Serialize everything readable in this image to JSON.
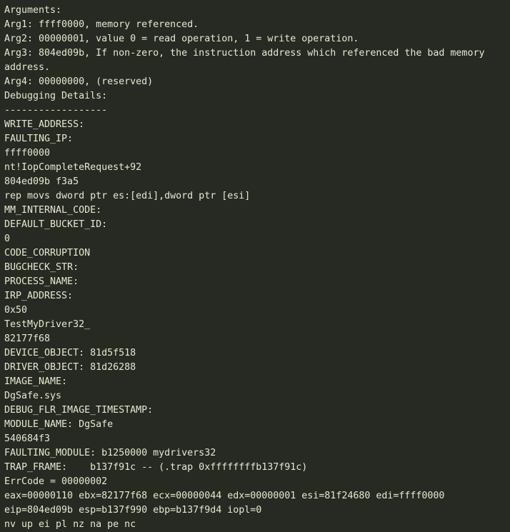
{
  "terminal": {
    "app": "windbg-bugcheck-analysis",
    "colors": {
      "background": "#262a22",
      "foreground": "#e8e8d0"
    },
    "lines": [
      "Arguments:",
      "Arg1: ffff0000, memory referenced.",
      "Arg2: 00000001, value 0 = read operation, 1 = write operation.",
      "Arg3: 804ed09b, If non-zero, the instruction address which referenced the bad memory",
      "address.",
      "Arg4: 00000000, (reserved)",
      "Debugging Details:",
      "------------------",
      "WRITE_ADDRESS:",
      "FAULTING_IP:",
      "ffff0000",
      "nt!IopCompleteRequest+92",
      "804ed09b f3a5",
      "rep movs dword ptr es:[edi],dword ptr [esi]",
      "MM_INTERNAL_CODE:",
      "DEFAULT_BUCKET_ID:",
      "0",
      "CODE_CORRUPTION",
      "BUGCHECK_STR:",
      "PROCESS_NAME:",
      "IRP_ADDRESS:",
      "0x50",
      "TestMyDriver32_",
      "82177f68",
      "DEVICE_OBJECT: 81d5f518",
      "DRIVER_OBJECT: 81d26288",
      "IMAGE_NAME:",
      "DgSafe.sys",
      "DEBUG_FLR_IMAGE_TIMESTAMP:",
      "MODULE_NAME: DgSafe",
      "540684f3",
      "FAULTING_MODULE: b1250000 mydrivers32",
      "TRAP_FRAME:    b137f91c -- (.trap 0xffffffffb137f91c)",
      "ErrCode = 00000002",
      "eax=00000110 ebx=82177f68 ecx=00000044 edx=00000001 esi=81f24680 edi=ffff0000",
      "eip=804ed09b esp=b137f990 ebp=b137f9d4 iopl=0",
      "nv up ei pl nz na pe nc"
    ]
  }
}
